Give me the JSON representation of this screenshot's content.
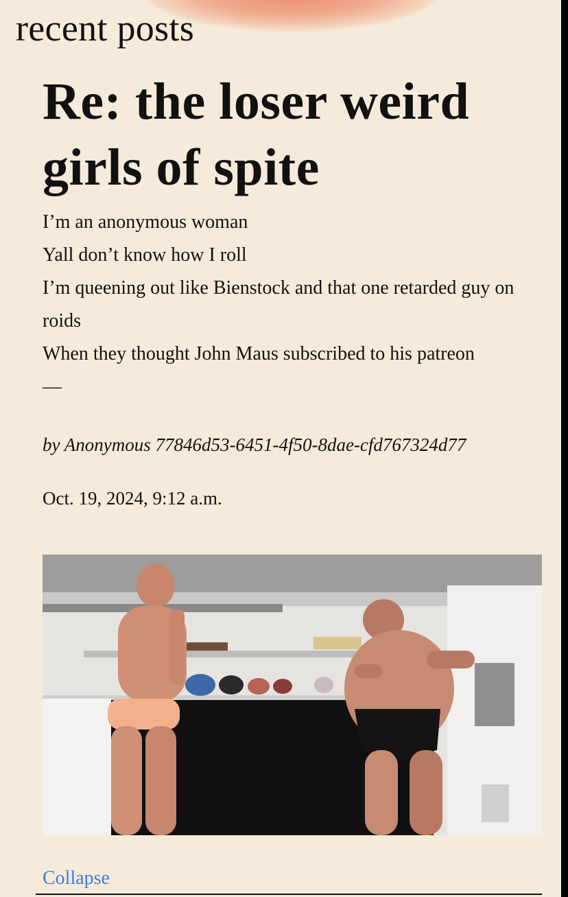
{
  "section": {
    "heading": "recent posts"
  },
  "post": {
    "title": "Re: the loser weird girls of spite",
    "body_lines": [
      "I’m an anonymous woman",
      "Yall don’t know how I roll",
      "I’m queening out like Bienstock and that one retarded guy on roids",
      "When they thought John Maus subscribed to his patreon",
      "—"
    ],
    "author": "by Anonymous 77846d53-6451-4f50-8dae-cfd767324d77",
    "timestamp": "Oct. 19, 2024, 9:12 a.m.",
    "media": {
      "description_icon": "video-frame-image"
    },
    "collapse_label": "Collapse"
  },
  "colors": {
    "background": "#f6ebdb",
    "text": "#111111",
    "link": "#3b7de0",
    "brush_accent": "#e87650"
  }
}
